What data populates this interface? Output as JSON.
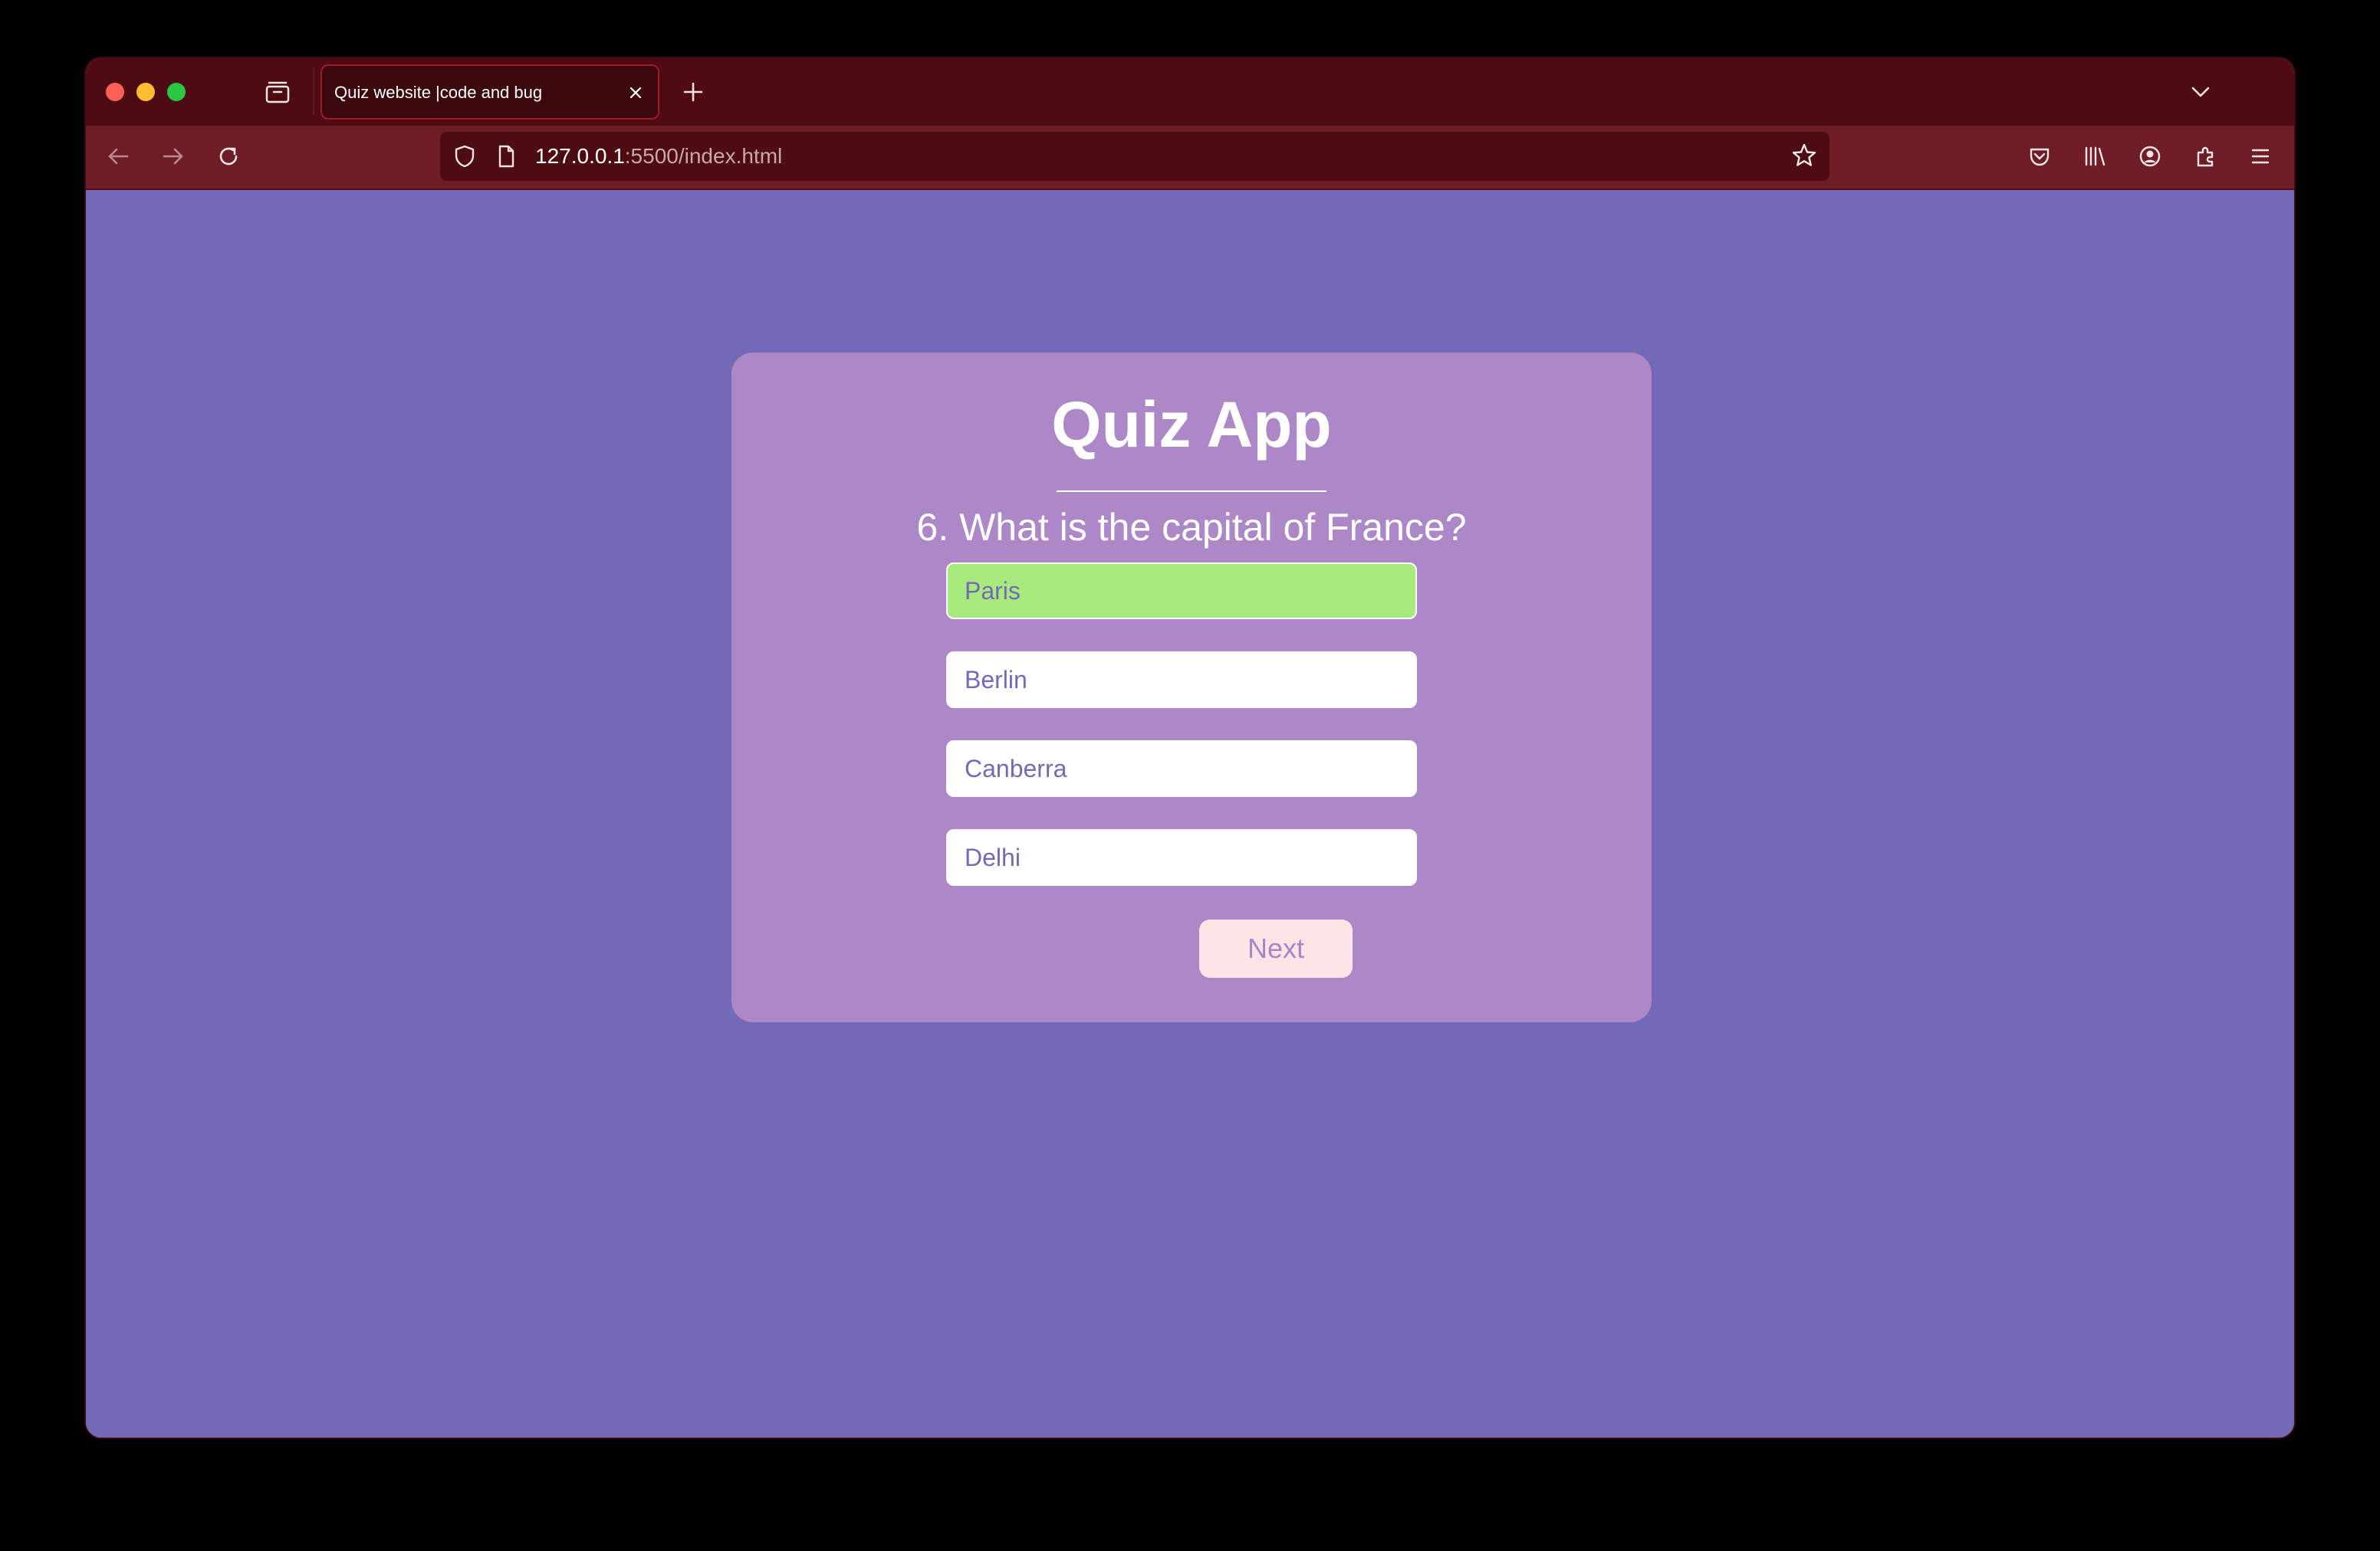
{
  "browser": {
    "tab": {
      "title": "Quiz website |code and bug"
    },
    "url": {
      "host": "127.0.0.1",
      "path": ":5500/index.html"
    },
    "icons": {
      "traffic_lights": [
        "close-window-icon",
        "minimize-window-icon",
        "zoom-window-icon"
      ],
      "toolbar": [
        "back-arrow-icon",
        "forward-arrow-icon",
        "reload-icon",
        "shield-icon",
        "page-icon",
        "bookmark-star-icon",
        "pocket-icon",
        "library-icon",
        "account-icon",
        "extensions-icon",
        "menu-icon"
      ]
    },
    "colors": {
      "tabbar": "#4f0b12",
      "toolbar": "#6e1d27"
    }
  },
  "quiz": {
    "title": "Quiz App",
    "question": "6. What is the capital of France?",
    "answers": [
      {
        "label": "Paris",
        "state": "correct"
      },
      {
        "label": "Berlin",
        "state": "default"
      },
      {
        "label": "Canberra",
        "state": "default"
      },
      {
        "label": "Delhi",
        "state": "default"
      }
    ],
    "next_label": "Next",
    "colors": {
      "page_background": "#7469b6",
      "card_background": "#ad88c6",
      "correct_answer": "#a9ea7c",
      "answer_text": "#7469b6",
      "next_button": "#fde4e6"
    }
  }
}
